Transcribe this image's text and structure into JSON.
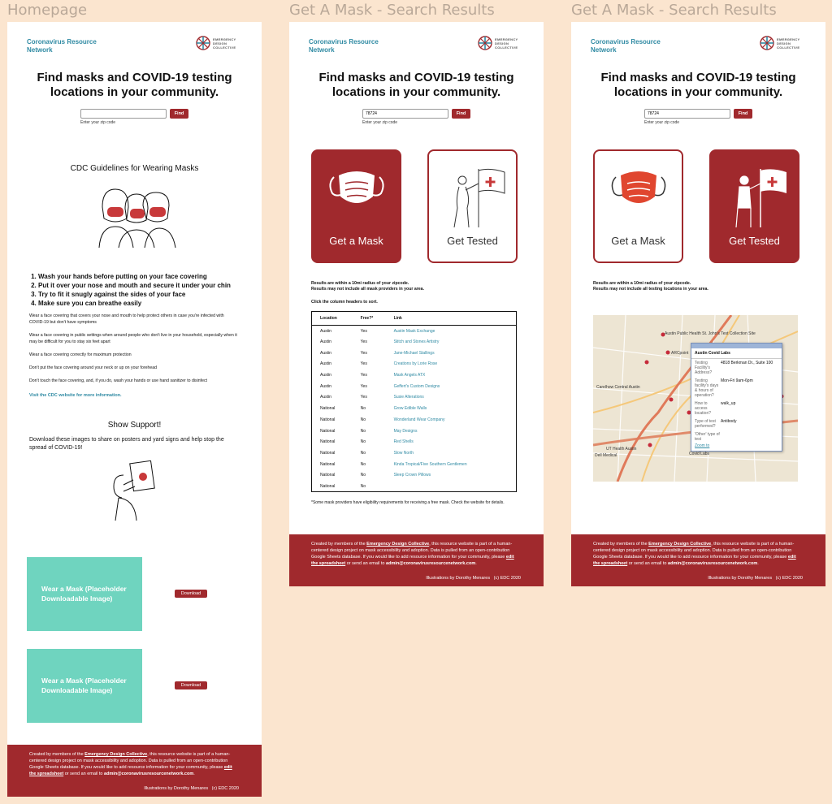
{
  "frames": [
    {
      "title": "Homepage"
    },
    {
      "title": "Get A Mask - Search Results"
    },
    {
      "title": "Get A Mask - Search Results"
    }
  ],
  "brand": {
    "name": "Coronavirus Resource Network",
    "logo_text": "EMERGENCY DESIGN COLLECTIVE"
  },
  "hero": {
    "heading": "Find masks and COVID-19 testing locations in your community.",
    "find_label": "Find",
    "zip_hint": "Enter your zip code",
    "zip_placeholder": "",
    "zip_value": "78724"
  },
  "home": {
    "cdc_title": "CDC Guidelines for Wearing Masks",
    "rules": [
      "Wash your hands before putting on your face covering",
      "Put it over your nose and mouth and secure it under your chin",
      "Try to fit it snugly against the sides of your face",
      "Make sure you can breathe easily"
    ],
    "paragraphs": [
      "Wear a face covering that covers your nose and mouth to help protect others in case you're infected with COVID-19 but don't have symptoms",
      "Wear a face covering in public settings when around people who don't live in your household, especially when it may be difficult for you to stay six feet apart",
      "Wear a face covering correctly for maximum protection",
      "Don't put the face covering around your neck or up on your forehead",
      "Don't touch the face covering, and, if you do, wash your hands or use hand sanitizer to disinfect"
    ],
    "cdc_link": "Visit the CDC website for more information.",
    "support_title": "Show Support!",
    "support_desc": "Download these images to share on posters and yard signs and help stop the spread of COVID-19!",
    "downloads": [
      {
        "card": "Wear a Mask (Placeholder Downloadable Image)",
        "button": "Download"
      },
      {
        "card": "Wear a Mask (Placeholder Downloadable Image)",
        "button": "Download"
      }
    ]
  },
  "footer": {
    "t1": "Created by members of the ",
    "link1": "Emergency Design Collective",
    "t2": ", this resource website is part of a human-centered design project on mask accessibility and adoption. Data is pulled from an open-contribution Google Sheets database. If you would like to add resource information for your community, please ",
    "link2": "edit the spreadsheet",
    "t3": " or send an email to ",
    "email": "admin@coronavirusresourcenetwork.com",
    "t4": ".",
    "illustrations": "Illustrations by Dorothy Menares",
    "copyright": "(c) EDC 2020"
  },
  "cards": {
    "mask": "Get a Mask",
    "test": "Get Tested"
  },
  "mask_results": {
    "note1": "Results are within a 10mi radius of your zipcode.",
    "note2": "Results may not include all mask providers in your area.",
    "sort_hint": "Click the column headers to sort.",
    "headers": [
      "Location",
      "Free?*",
      "Link"
    ],
    "rows": [
      [
        "Austin",
        "Yes",
        "Austin Mask Exchange"
      ],
      [
        "Austin",
        "Yes",
        "Stitch and Stones Artistry"
      ],
      [
        "Austin",
        "Yes",
        "Jane-Michael Stallings"
      ],
      [
        "Austin",
        "Yes",
        "Creations by Lorie Rose"
      ],
      [
        "Austin",
        "Yes",
        "Mask Angels ATX"
      ],
      [
        "Austin",
        "Yes",
        "Geffert's Custom Designs"
      ],
      [
        "Austin",
        "Yes",
        "Susie Alterations"
      ],
      [
        "National",
        "No",
        "Grow Edible Walls"
      ],
      [
        "National",
        "No",
        "Wonderland Wear Company"
      ],
      [
        "National",
        "No",
        "May Designs"
      ],
      [
        "National",
        "No",
        "Red Shells"
      ],
      [
        "National",
        "No",
        "Slow North"
      ],
      [
        "National",
        "No",
        "Kinda Tropical/Five Southern Gentlemen"
      ],
      [
        "National",
        "No",
        "Sleep Crown Pillows"
      ],
      [
        "National",
        "No",
        ""
      ]
    ],
    "footnote": "*Some mask providers have eligibility requirements for receiving a free mask. Check the website for details."
  },
  "test_results": {
    "note1": "Results are within a 10mi radius of your zipcode.",
    "note2": "Results may not include all testing locations in your area.",
    "map": {
      "labels": [
        "Austin Public Health St. John's Test Collection Site",
        "ARCpoint",
        "Carelhow Central Austin",
        "UT Health Austin",
        "Dell Medical",
        "Covid Labs"
      ],
      "popup": {
        "title": "Austin Covid Labs",
        "fields": [
          {
            "k": "Testing Facility's Address?",
            "v": "4818 Berkman Dr., Suite 100"
          },
          {
            "k": "Testing facility's days & hours of operation?",
            "v": "Mon-Fri 9am-6pm"
          },
          {
            "k": "How to access location?",
            "v": "walk_up"
          },
          {
            "k": "Type of test performed?",
            "v": "Antibody"
          },
          {
            "k": "'Other' type of test",
            "v": ""
          }
        ],
        "zoom": "Zoom to"
      }
    }
  },
  "colors": {
    "brand_red": "#a0292d",
    "teal": "#2f8aa3",
    "mint": "#6fd4bf",
    "canvas": "#fbe5cf"
  }
}
